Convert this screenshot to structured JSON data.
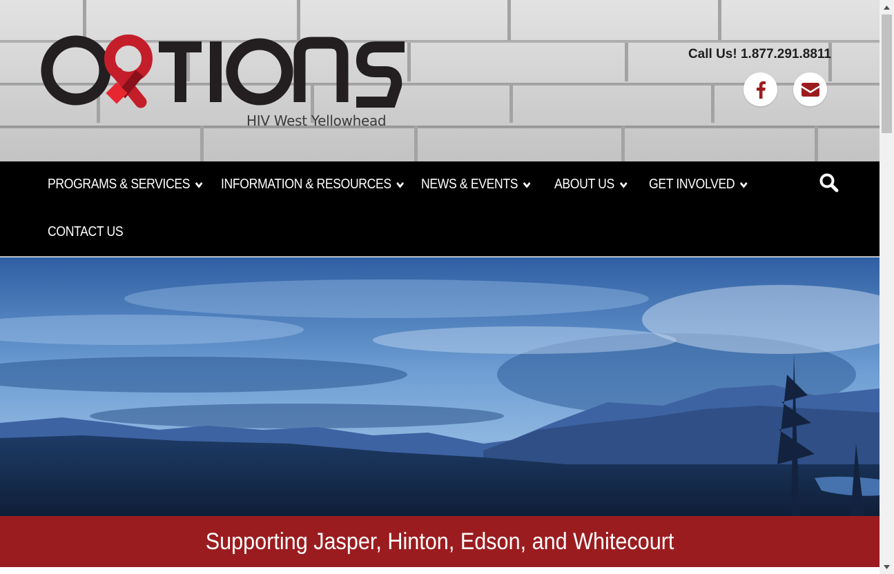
{
  "header": {
    "logo_text": "OPTIONS",
    "logo_subtitle": "HIV West Yellowhead",
    "call_us": "Call Us! 1.877.291.8811",
    "social": [
      {
        "name": "facebook",
        "icon": "facebook-icon"
      },
      {
        "name": "email",
        "icon": "envelope-icon"
      }
    ]
  },
  "nav": {
    "items": [
      {
        "label": "PROGRAMS & SERVICES",
        "has_dropdown": true
      },
      {
        "label": "INFORMATION & RESOURCES",
        "has_dropdown": true
      },
      {
        "label": "NEWS & EVENTS",
        "has_dropdown": true
      },
      {
        "label": "ABOUT US",
        "has_dropdown": true
      },
      {
        "label": "GET INVOLVED",
        "has_dropdown": true
      },
      {
        "label": "CONTACT US",
        "has_dropdown": false
      }
    ],
    "search_icon": "search-icon"
  },
  "hero": {
    "image": "mountain-landscape-at-dusk"
  },
  "banner": {
    "text": "Supporting Jasper, Hinton, Edson, and Whitecourt"
  },
  "colors": {
    "brand_red": "#c41e2a",
    "banner_red": "#9b1c1f",
    "nav_bg": "#000000",
    "logo_dark": "#231f20"
  }
}
